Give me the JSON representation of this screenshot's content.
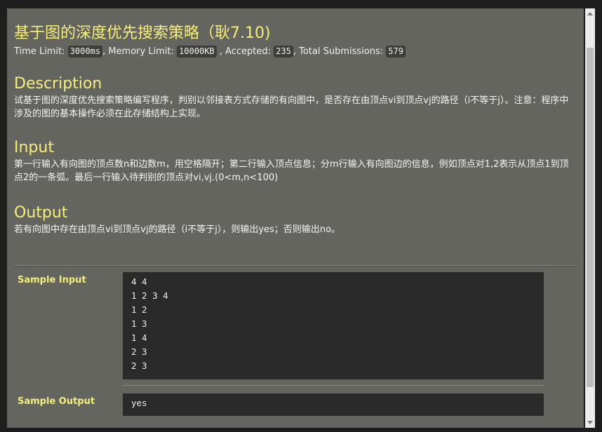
{
  "problem": {
    "title": "基于图的深度优先搜索策略（耿7.10)",
    "time_limit_label": "Time Limit:",
    "time_limit": "3000ms",
    "memory_limit_label": ", Memory Limit:",
    "memory_limit": "10000KB",
    "accepted_label": ", Accepted:",
    "accepted": "235",
    "submissions_label": ", Total Submissions:",
    "submissions": "579"
  },
  "description": {
    "heading": "Description",
    "text": "试基于图的深度优先搜索策略编写程序，判别以邻接表方式存储的有向图中，是否存在由顶点vi到顶点vj的路径（i不等于j）。注意：程序中涉及的图的基本操作必须在此存储结构上实现。"
  },
  "input": {
    "heading": "Input",
    "text": "第一行输入有向图的顶点数n和边数m，用空格隔开；第二行输入顶点信息；分m行输入有向图边的信息，例如顶点对1,2表示从顶点1到顶点2的一条弧。最后一行输入待判别的顶点对vi,vj.(0<m,n<100)"
  },
  "output": {
    "heading": "Output",
    "text": "若有向图中存在由顶点vi到顶点vj的路径（i不等于j），则输出yes；否则输出no。"
  },
  "sample_input": {
    "label": "Sample Input",
    "lines": [
      "4 4",
      "1 2 3 4",
      "1 2",
      "1 3",
      "1 4",
      "2 3",
      "2 3"
    ]
  },
  "sample_output": {
    "label": "Sample Output",
    "lines": [
      "yes"
    ]
  },
  "colors": {
    "heading": "#f6ee7a",
    "panel_bg": "#656560",
    "code_bg": "#2a2a2a"
  }
}
